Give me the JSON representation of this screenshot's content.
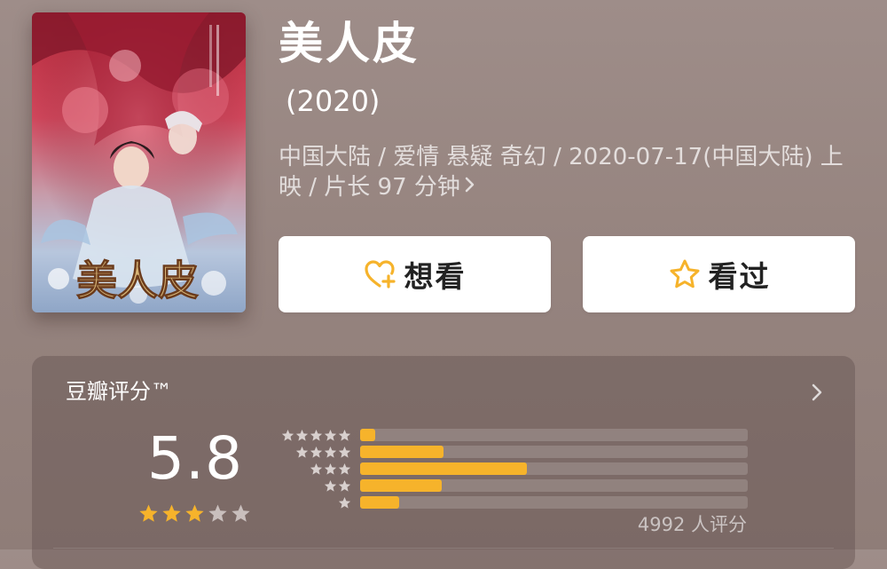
{
  "movie": {
    "title": "美人皮",
    "year": "(2020)",
    "meta_text": "中国大陆 / 爱情 悬疑 奇幻 / 2020-07-17(中国大陆) 上映 / 片长 97 分钟",
    "poster_text": "美人皮"
  },
  "actions": {
    "want_label": "想看",
    "seen_label": "看过",
    "want_icon": "heart-plus-icon",
    "seen_icon": "star-outline-icon"
  },
  "rating": {
    "label": "豆瓣评分™",
    "score": "5.8",
    "score_stars": 3,
    "score_stars_total": 5,
    "count_text": "4992 人评分",
    "distribution": [
      {
        "stars": 5,
        "fraction": 0.04
      },
      {
        "stars": 4,
        "fraction": 0.215
      },
      {
        "stars": 3,
        "fraction": 0.43
      },
      {
        "stars": 2,
        "fraction": 0.21
      },
      {
        "stars": 1,
        "fraction": 0.1
      }
    ]
  },
  "colors": {
    "accent": "#f6b32b",
    "background": "#9a8985",
    "button_bg": "#ffffff",
    "star_empty": "#c9bfbd"
  }
}
